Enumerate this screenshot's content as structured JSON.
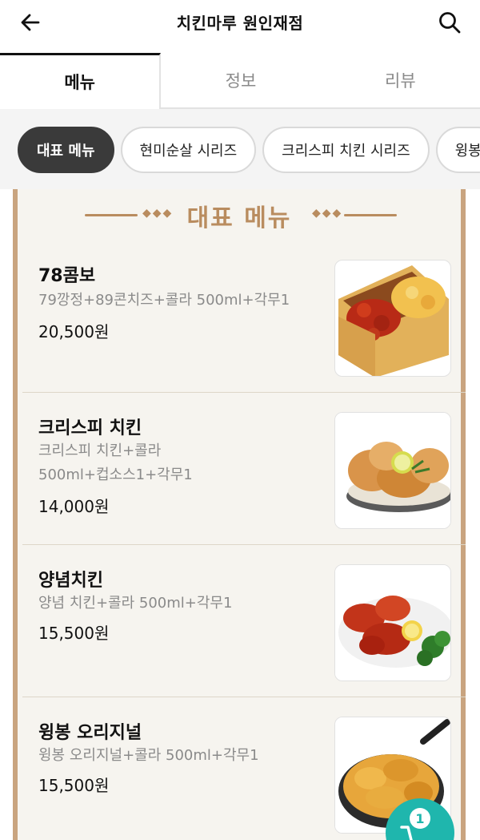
{
  "header": {
    "title": "치킨마루 원인재점",
    "back_icon": "arrow-left-icon",
    "search_icon": "search-icon"
  },
  "tabs": [
    {
      "label": "메뉴",
      "active": true
    },
    {
      "label": "정보",
      "active": false
    },
    {
      "label": "리뷰",
      "active": false
    }
  ],
  "chips": [
    {
      "label": "대표 메뉴",
      "active": true
    },
    {
      "label": "현미순살 시리즈",
      "active": false
    },
    {
      "label": "크리스피 치킨 시리즈",
      "active": false
    },
    {
      "label": "윙봉",
      "active": false
    }
  ],
  "section": {
    "title": "대표 메뉴"
  },
  "menu_items": [
    {
      "name": "78콤보",
      "description": "79깡정+89콘치즈+콜라 500ml+각무1",
      "price": "20,500원",
      "image_icon": "fried-chicken-box-image"
    },
    {
      "name": "크리스피 치킨",
      "description": "크리스피 치킨+콜라 500ml+컵소스1+각무1",
      "price": "14,000원",
      "image_icon": "crispy-chicken-image"
    },
    {
      "name": "양념치킨",
      "description": "양념 치킨+콜라 500ml+각무1",
      "price": "15,500원",
      "image_icon": "seasoned-chicken-image"
    },
    {
      "name": "윙봉 오리지널",
      "description": "윙봉 오리지널+콜라 500ml+각무1",
      "price": "15,500원",
      "image_icon": "wing-chicken-image"
    }
  ],
  "cart": {
    "badge_count": "1",
    "icon": "cart-icon"
  },
  "colors": {
    "accent_gold": "#b98c5f",
    "board_border": "#c9a47f",
    "cart_teal": "#1fb6ad",
    "chip_active": "#3a3a3a"
  }
}
